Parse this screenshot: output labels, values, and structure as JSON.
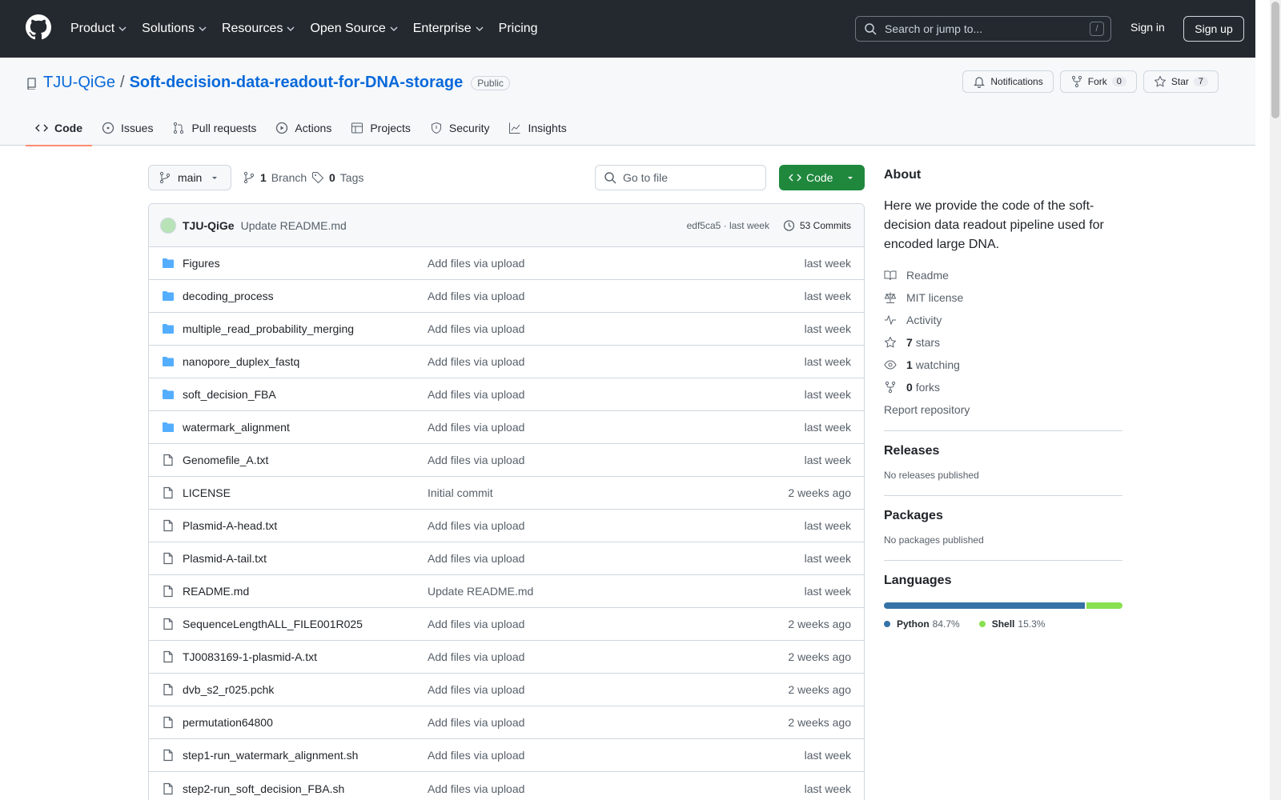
{
  "header": {
    "nav": [
      "Product",
      "Solutions",
      "Resources",
      "Open Source",
      "Enterprise",
      "Pricing"
    ],
    "search_placeholder": "Search or jump to...",
    "search_key": "/",
    "signin": "Sign in",
    "signup": "Sign up"
  },
  "repo": {
    "owner": "TJU-QiGe",
    "separator": "/",
    "name": "Soft-decision-data-readout-for-DNA-storage",
    "visibility": "Public",
    "notifications_label": "Notifications",
    "fork_label": "Fork",
    "fork_count": "0",
    "star_label": "Star",
    "star_count": "7"
  },
  "tabs": [
    "Code",
    "Issues",
    "Pull requests",
    "Actions",
    "Projects",
    "Security",
    "Insights"
  ],
  "toolbar": {
    "branch": "main",
    "branch_count": "1",
    "branch_label": "Branch",
    "tag_count": "0",
    "tag_label": "Tags",
    "goto_placeholder": "Go to file",
    "code_label": "Code"
  },
  "commit": {
    "author": "TJU-QiGe",
    "message": "Update README.md",
    "hash_time": "edf5ca5 · last week",
    "count_label": "53 Commits"
  },
  "files": [
    {
      "name": "Figures",
      "type": "folder",
      "msg": "Add files via upload",
      "date": "last week"
    },
    {
      "name": "decoding_process",
      "type": "folder",
      "msg": "Add files via upload",
      "date": "last week"
    },
    {
      "name": "multiple_read_probability_merging",
      "type": "folder",
      "msg": "Add files via upload",
      "date": "last week"
    },
    {
      "name": "nanopore_duplex_fastq",
      "type": "folder",
      "msg": "Add files via upload",
      "date": "last week"
    },
    {
      "name": "soft_decision_FBA",
      "type": "folder",
      "msg": "Add files via upload",
      "date": "last week"
    },
    {
      "name": "watermark_alignment",
      "type": "folder",
      "msg": "Add files via upload",
      "date": "last week"
    },
    {
      "name": "Genomefile_A.txt",
      "type": "file",
      "msg": "Add files via upload",
      "date": "last week"
    },
    {
      "name": "LICENSE",
      "type": "file",
      "msg": "Initial commit",
      "date": "2 weeks ago"
    },
    {
      "name": "Plasmid-A-head.txt",
      "type": "file",
      "msg": "Add files via upload",
      "date": "last week"
    },
    {
      "name": "Plasmid-A-tail.txt",
      "type": "file",
      "msg": "Add files via upload",
      "date": "last week"
    },
    {
      "name": "README.md",
      "type": "file",
      "msg": "Update README.md",
      "date": "last week"
    },
    {
      "name": "SequenceLengthALL_FILE001R025",
      "type": "file",
      "msg": "Add files via upload",
      "date": "2 weeks ago"
    },
    {
      "name": "TJ0083169-1-plasmid-A.txt",
      "type": "file",
      "msg": "Add files via upload",
      "date": "2 weeks ago"
    },
    {
      "name": "dvb_s2_r025.pchk",
      "type": "file",
      "msg": "Add files via upload",
      "date": "2 weeks ago"
    },
    {
      "name": "permutation64800",
      "type": "file",
      "msg": "Add files via upload",
      "date": "2 weeks ago"
    },
    {
      "name": "step1-run_watermark_alignment.sh",
      "type": "file",
      "msg": "Add files via upload",
      "date": "last week"
    },
    {
      "name": "step2-run_soft_decision_FBA.sh",
      "type": "file",
      "msg": "Add files via upload",
      "date": "last week"
    }
  ],
  "about": {
    "title": "About",
    "description": "Here we provide the code of the soft-decision data readout pipeline used for encoded large DNA.",
    "readme": "Readme",
    "license": "MIT license",
    "activity": "Activity",
    "stars_count": "7",
    "stars_label": "stars",
    "watching_count": "1",
    "watching_label": "watching",
    "forks_count": "0",
    "forks_label": "forks",
    "report": "Report repository"
  },
  "releases": {
    "title": "Releases",
    "empty": "No releases published"
  },
  "packages": {
    "title": "Packages",
    "empty": "No packages published"
  },
  "languages": {
    "title": "Languages",
    "items": [
      {
        "name": "Python",
        "percent": "84.7%",
        "value": 84.7,
        "color": "#3572A5"
      },
      {
        "name": "Shell",
        "percent": "15.3%",
        "value": 15.3,
        "color": "#89e051"
      }
    ]
  },
  "colors": {
    "header_bg": "#24292f",
    "accent": "#0969da",
    "code_button": "#1f883d",
    "tab_underline": "#fd8c73"
  }
}
